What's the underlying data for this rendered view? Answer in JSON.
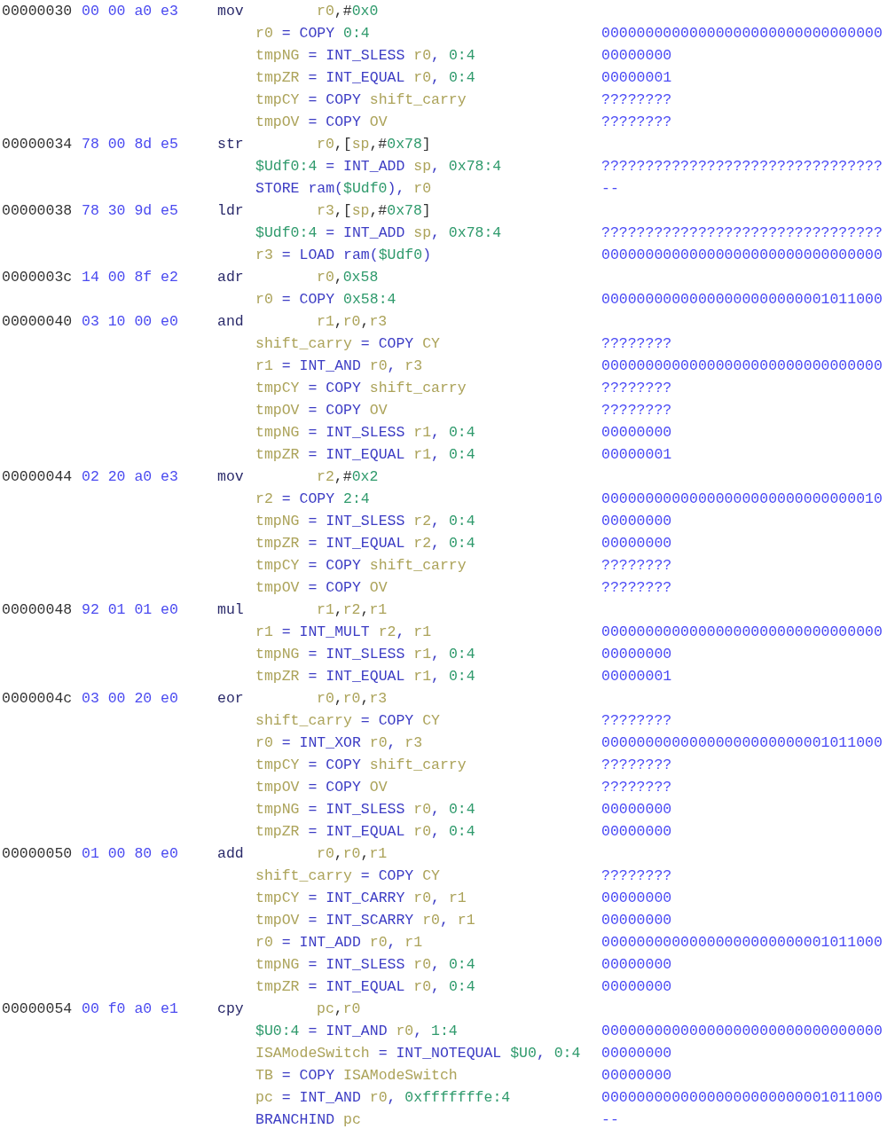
{
  "listing": [
    {
      "address": "00000030",
      "bytes": "00 00 a0 e3",
      "mnemonic": "mov",
      "operands": [
        {
          "kind": "var",
          "text": "r0"
        },
        {
          "kind": "plain",
          "text": ",#"
        },
        {
          "kind": "const",
          "text": "0x0"
        }
      ],
      "pcode": [
        {
          "tokens": [
            {
              "kind": "var",
              "text": "r0"
            },
            {
              "kind": "sym",
              "text": " = "
            },
            {
              "kind": "op",
              "text": "COPY"
            },
            {
              "kind": "const",
              "text": "0:4"
            }
          ],
          "value": "00000000000000000000000000000000"
        },
        {
          "tokens": [
            {
              "kind": "var",
              "text": "tmpNG"
            },
            {
              "kind": "sym",
              "text": " = "
            },
            {
              "kind": "op",
              "text": "INT_SLESS"
            },
            {
              "kind": "var",
              "text": "r0"
            },
            {
              "kind": "sym",
              "text": ", "
            },
            {
              "kind": "const",
              "text": "0:4"
            }
          ],
          "value": "00000000"
        },
        {
          "tokens": [
            {
              "kind": "var",
              "text": "tmpZR"
            },
            {
              "kind": "sym",
              "text": " = "
            },
            {
              "kind": "op",
              "text": "INT_EQUAL"
            },
            {
              "kind": "var",
              "text": "r0"
            },
            {
              "kind": "sym",
              "text": ", "
            },
            {
              "kind": "const",
              "text": "0:4"
            }
          ],
          "value": "00000001"
        },
        {
          "tokens": [
            {
              "kind": "var",
              "text": "tmpCY"
            },
            {
              "kind": "sym",
              "text": " = "
            },
            {
              "kind": "op",
              "text": "COPY"
            },
            {
              "kind": "var",
              "text": "shift_carry"
            }
          ],
          "value": "????????"
        },
        {
          "tokens": [
            {
              "kind": "var",
              "text": "tmpOV"
            },
            {
              "kind": "sym",
              "text": " = "
            },
            {
              "kind": "op",
              "text": "COPY"
            },
            {
              "kind": "var",
              "text": "OV"
            }
          ],
          "value": "????????"
        }
      ]
    },
    {
      "address": "00000034",
      "bytes": "78 00 8d e5",
      "mnemonic": "str",
      "operands": [
        {
          "kind": "var",
          "text": "r0"
        },
        {
          "kind": "plain",
          "text": ",["
        },
        {
          "kind": "var",
          "text": "sp"
        },
        {
          "kind": "plain",
          "text": ",#"
        },
        {
          "kind": "const",
          "text": "0x78"
        },
        {
          "kind": "plain",
          "text": "]"
        }
      ],
      "pcode": [
        {
          "tokens": [
            {
              "kind": "unique",
              "text": "$Udf0:4"
            },
            {
              "kind": "sym",
              "text": " = "
            },
            {
              "kind": "op",
              "text": "INT_ADD"
            },
            {
              "kind": "var",
              "text": "sp"
            },
            {
              "kind": "sym",
              "text": ", "
            },
            {
              "kind": "const",
              "text": "0x78:4"
            }
          ],
          "value": "????????????????????????????????"
        },
        {
          "tokens": [
            {
              "kind": "op",
              "text": "STORE"
            },
            {
              "kind": "sym",
              "text": "ram("
            },
            {
              "kind": "unique",
              "text": "$Udf0"
            },
            {
              "kind": "sym",
              "text": "), "
            },
            {
              "kind": "var",
              "text": "r0"
            }
          ],
          "value": "--"
        }
      ]
    },
    {
      "address": "00000038",
      "bytes": "78 30 9d e5",
      "mnemonic": "ldr",
      "operands": [
        {
          "kind": "var",
          "text": "r3"
        },
        {
          "kind": "plain",
          "text": ",["
        },
        {
          "kind": "var",
          "text": "sp"
        },
        {
          "kind": "plain",
          "text": ",#"
        },
        {
          "kind": "const",
          "text": "0x78"
        },
        {
          "kind": "plain",
          "text": "]"
        }
      ],
      "pcode": [
        {
          "tokens": [
            {
              "kind": "unique",
              "text": "$Udf0:4"
            },
            {
              "kind": "sym",
              "text": " = "
            },
            {
              "kind": "op",
              "text": "INT_ADD"
            },
            {
              "kind": "var",
              "text": "sp"
            },
            {
              "kind": "sym",
              "text": ", "
            },
            {
              "kind": "const",
              "text": "0x78:4"
            }
          ],
          "value": "????????????????????????????????"
        },
        {
          "tokens": [
            {
              "kind": "var",
              "text": "r3"
            },
            {
              "kind": "sym",
              "text": " = "
            },
            {
              "kind": "op",
              "text": "LOAD"
            },
            {
              "kind": "sym",
              "text": "ram("
            },
            {
              "kind": "unique",
              "text": "$Udf0"
            },
            {
              "kind": "sym",
              "text": ")"
            }
          ],
          "value": "00000000000000000000000000000000"
        }
      ]
    },
    {
      "address": "0000003c",
      "bytes": "14 00 8f e2",
      "mnemonic": "adr",
      "operands": [
        {
          "kind": "var",
          "text": "r0"
        },
        {
          "kind": "plain",
          "text": ","
        },
        {
          "kind": "const",
          "text": "0x58"
        }
      ],
      "pcode": [
        {
          "tokens": [
            {
              "kind": "var",
              "text": "r0"
            },
            {
              "kind": "sym",
              "text": " = "
            },
            {
              "kind": "op",
              "text": "COPY"
            },
            {
              "kind": "const",
              "text": "0x58:4"
            }
          ],
          "value": "00000000000000000000000001011000"
        }
      ]
    },
    {
      "address": "00000040",
      "bytes": "03 10 00 e0",
      "mnemonic": "and",
      "operands": [
        {
          "kind": "var",
          "text": "r1"
        },
        {
          "kind": "plain",
          "text": ","
        },
        {
          "kind": "var",
          "text": "r0"
        },
        {
          "kind": "plain",
          "text": ","
        },
        {
          "kind": "var",
          "text": "r3"
        }
      ],
      "pcode": [
        {
          "tokens": [
            {
              "kind": "var",
              "text": "shift_carry"
            },
            {
              "kind": "sym",
              "text": " = "
            },
            {
              "kind": "op",
              "text": "COPY"
            },
            {
              "kind": "var",
              "text": "CY"
            }
          ],
          "value": "????????"
        },
        {
          "tokens": [
            {
              "kind": "var",
              "text": "r1"
            },
            {
              "kind": "sym",
              "text": " = "
            },
            {
              "kind": "op",
              "text": "INT_AND"
            },
            {
              "kind": "var",
              "text": "r0"
            },
            {
              "kind": "sym",
              "text": ", "
            },
            {
              "kind": "var",
              "text": "r3"
            }
          ],
          "value": "00000000000000000000000000000000"
        },
        {
          "tokens": [
            {
              "kind": "var",
              "text": "tmpCY"
            },
            {
              "kind": "sym",
              "text": " = "
            },
            {
              "kind": "op",
              "text": "COPY"
            },
            {
              "kind": "var",
              "text": "shift_carry"
            }
          ],
          "value": "????????"
        },
        {
          "tokens": [
            {
              "kind": "var",
              "text": "tmpOV"
            },
            {
              "kind": "sym",
              "text": " = "
            },
            {
              "kind": "op",
              "text": "COPY"
            },
            {
              "kind": "var",
              "text": "OV"
            }
          ],
          "value": "????????"
        },
        {
          "tokens": [
            {
              "kind": "var",
              "text": "tmpNG"
            },
            {
              "kind": "sym",
              "text": " = "
            },
            {
              "kind": "op",
              "text": "INT_SLESS"
            },
            {
              "kind": "var",
              "text": "r1"
            },
            {
              "kind": "sym",
              "text": ", "
            },
            {
              "kind": "const",
              "text": "0:4"
            }
          ],
          "value": "00000000"
        },
        {
          "tokens": [
            {
              "kind": "var",
              "text": "tmpZR"
            },
            {
              "kind": "sym",
              "text": " = "
            },
            {
              "kind": "op",
              "text": "INT_EQUAL"
            },
            {
              "kind": "var",
              "text": "r1"
            },
            {
              "kind": "sym",
              "text": ", "
            },
            {
              "kind": "const",
              "text": "0:4"
            }
          ],
          "value": "00000001"
        }
      ]
    },
    {
      "address": "00000044",
      "bytes": "02 20 a0 e3",
      "mnemonic": "mov",
      "operands": [
        {
          "kind": "var",
          "text": "r2"
        },
        {
          "kind": "plain",
          "text": ",#"
        },
        {
          "kind": "const",
          "text": "0x2"
        }
      ],
      "pcode": [
        {
          "tokens": [
            {
              "kind": "var",
              "text": "r2"
            },
            {
              "kind": "sym",
              "text": " = "
            },
            {
              "kind": "op",
              "text": "COPY"
            },
            {
              "kind": "const",
              "text": "2:4"
            }
          ],
          "value": "00000000000000000000000000000010"
        },
        {
          "tokens": [
            {
              "kind": "var",
              "text": "tmpNG"
            },
            {
              "kind": "sym",
              "text": " = "
            },
            {
              "kind": "op",
              "text": "INT_SLESS"
            },
            {
              "kind": "var",
              "text": "r2"
            },
            {
              "kind": "sym",
              "text": ", "
            },
            {
              "kind": "const",
              "text": "0:4"
            }
          ],
          "value": "00000000"
        },
        {
          "tokens": [
            {
              "kind": "var",
              "text": "tmpZR"
            },
            {
              "kind": "sym",
              "text": " = "
            },
            {
              "kind": "op",
              "text": "INT_EQUAL"
            },
            {
              "kind": "var",
              "text": "r2"
            },
            {
              "kind": "sym",
              "text": ", "
            },
            {
              "kind": "const",
              "text": "0:4"
            }
          ],
          "value": "00000000"
        },
        {
          "tokens": [
            {
              "kind": "var",
              "text": "tmpCY"
            },
            {
              "kind": "sym",
              "text": " = "
            },
            {
              "kind": "op",
              "text": "COPY"
            },
            {
              "kind": "var",
              "text": "shift_carry"
            }
          ],
          "value": "????????"
        },
        {
          "tokens": [
            {
              "kind": "var",
              "text": "tmpOV"
            },
            {
              "kind": "sym",
              "text": " = "
            },
            {
              "kind": "op",
              "text": "COPY"
            },
            {
              "kind": "var",
              "text": "OV"
            }
          ],
          "value": "????????"
        }
      ]
    },
    {
      "address": "00000048",
      "bytes": "92 01 01 e0",
      "mnemonic": "mul",
      "operands": [
        {
          "kind": "var",
          "text": "r1"
        },
        {
          "kind": "plain",
          "text": ","
        },
        {
          "kind": "var",
          "text": "r2"
        },
        {
          "kind": "plain",
          "text": ","
        },
        {
          "kind": "var",
          "text": "r1"
        }
      ],
      "pcode": [
        {
          "tokens": [
            {
              "kind": "var",
              "text": "r1"
            },
            {
              "kind": "sym",
              "text": " = "
            },
            {
              "kind": "op",
              "text": "INT_MULT"
            },
            {
              "kind": "var",
              "text": "r2"
            },
            {
              "kind": "sym",
              "text": ", "
            },
            {
              "kind": "var",
              "text": "r1"
            }
          ],
          "value": "00000000000000000000000000000000"
        },
        {
          "tokens": [
            {
              "kind": "var",
              "text": "tmpNG"
            },
            {
              "kind": "sym",
              "text": " = "
            },
            {
              "kind": "op",
              "text": "INT_SLESS"
            },
            {
              "kind": "var",
              "text": "r1"
            },
            {
              "kind": "sym",
              "text": ", "
            },
            {
              "kind": "const",
              "text": "0:4"
            }
          ],
          "value": "00000000"
        },
        {
          "tokens": [
            {
              "kind": "var",
              "text": "tmpZR"
            },
            {
              "kind": "sym",
              "text": " = "
            },
            {
              "kind": "op",
              "text": "INT_EQUAL"
            },
            {
              "kind": "var",
              "text": "r1"
            },
            {
              "kind": "sym",
              "text": ", "
            },
            {
              "kind": "const",
              "text": "0:4"
            }
          ],
          "value": "00000001"
        }
      ]
    },
    {
      "address": "0000004c",
      "bytes": "03 00 20 e0",
      "mnemonic": "eor",
      "operands": [
        {
          "kind": "var",
          "text": "r0"
        },
        {
          "kind": "plain",
          "text": ","
        },
        {
          "kind": "var",
          "text": "r0"
        },
        {
          "kind": "plain",
          "text": ","
        },
        {
          "kind": "var",
          "text": "r3"
        }
      ],
      "pcode": [
        {
          "tokens": [
            {
              "kind": "var",
              "text": "shift_carry"
            },
            {
              "kind": "sym",
              "text": " = "
            },
            {
              "kind": "op",
              "text": "COPY"
            },
            {
              "kind": "var",
              "text": "CY"
            }
          ],
          "value": "????????"
        },
        {
          "tokens": [
            {
              "kind": "var",
              "text": "r0"
            },
            {
              "kind": "sym",
              "text": " = "
            },
            {
              "kind": "op",
              "text": "INT_XOR"
            },
            {
              "kind": "var",
              "text": "r0"
            },
            {
              "kind": "sym",
              "text": ", "
            },
            {
              "kind": "var",
              "text": "r3"
            }
          ],
          "value": "00000000000000000000000001011000"
        },
        {
          "tokens": [
            {
              "kind": "var",
              "text": "tmpCY"
            },
            {
              "kind": "sym",
              "text": " = "
            },
            {
              "kind": "op",
              "text": "COPY"
            },
            {
              "kind": "var",
              "text": "shift_carry"
            }
          ],
          "value": "????????"
        },
        {
          "tokens": [
            {
              "kind": "var",
              "text": "tmpOV"
            },
            {
              "kind": "sym",
              "text": " = "
            },
            {
              "kind": "op",
              "text": "COPY"
            },
            {
              "kind": "var",
              "text": "OV"
            }
          ],
          "value": "????????"
        },
        {
          "tokens": [
            {
              "kind": "var",
              "text": "tmpNG"
            },
            {
              "kind": "sym",
              "text": " = "
            },
            {
              "kind": "op",
              "text": "INT_SLESS"
            },
            {
              "kind": "var",
              "text": "r0"
            },
            {
              "kind": "sym",
              "text": ", "
            },
            {
              "kind": "const",
              "text": "0:4"
            }
          ],
          "value": "00000000"
        },
        {
          "tokens": [
            {
              "kind": "var",
              "text": "tmpZR"
            },
            {
              "kind": "sym",
              "text": " = "
            },
            {
              "kind": "op",
              "text": "INT_EQUAL"
            },
            {
              "kind": "var",
              "text": "r0"
            },
            {
              "kind": "sym",
              "text": ", "
            },
            {
              "kind": "const",
              "text": "0:4"
            }
          ],
          "value": "00000000"
        }
      ]
    },
    {
      "address": "00000050",
      "bytes": "01 00 80 e0",
      "mnemonic": "add",
      "operands": [
        {
          "kind": "var",
          "text": "r0"
        },
        {
          "kind": "plain",
          "text": ","
        },
        {
          "kind": "var",
          "text": "r0"
        },
        {
          "kind": "plain",
          "text": ","
        },
        {
          "kind": "var",
          "text": "r1"
        }
      ],
      "pcode": [
        {
          "tokens": [
            {
              "kind": "var",
              "text": "shift_carry"
            },
            {
              "kind": "sym",
              "text": " = "
            },
            {
              "kind": "op",
              "text": "COPY"
            },
            {
              "kind": "var",
              "text": "CY"
            }
          ],
          "value": "????????"
        },
        {
          "tokens": [
            {
              "kind": "var",
              "text": "tmpCY"
            },
            {
              "kind": "sym",
              "text": " = "
            },
            {
              "kind": "op",
              "text": "INT_CARRY"
            },
            {
              "kind": "var",
              "text": "r0"
            },
            {
              "kind": "sym",
              "text": ", "
            },
            {
              "kind": "var",
              "text": "r1"
            }
          ],
          "value": "00000000"
        },
        {
          "tokens": [
            {
              "kind": "var",
              "text": "tmpOV"
            },
            {
              "kind": "sym",
              "text": " = "
            },
            {
              "kind": "op",
              "text": "INT_SCARRY"
            },
            {
              "kind": "var",
              "text": "r0"
            },
            {
              "kind": "sym",
              "text": ", "
            },
            {
              "kind": "var",
              "text": "r1"
            }
          ],
          "value": "00000000"
        },
        {
          "tokens": [
            {
              "kind": "var",
              "text": "r0"
            },
            {
              "kind": "sym",
              "text": " = "
            },
            {
              "kind": "op",
              "text": "INT_ADD"
            },
            {
              "kind": "var",
              "text": "r0"
            },
            {
              "kind": "sym",
              "text": ", "
            },
            {
              "kind": "var",
              "text": "r1"
            }
          ],
          "value": "00000000000000000000000001011000"
        },
        {
          "tokens": [
            {
              "kind": "var",
              "text": "tmpNG"
            },
            {
              "kind": "sym",
              "text": " = "
            },
            {
              "kind": "op",
              "text": "INT_SLESS"
            },
            {
              "kind": "var",
              "text": "r0"
            },
            {
              "kind": "sym",
              "text": ", "
            },
            {
              "kind": "const",
              "text": "0:4"
            }
          ],
          "value": "00000000"
        },
        {
          "tokens": [
            {
              "kind": "var",
              "text": "tmpZR"
            },
            {
              "kind": "sym",
              "text": " = "
            },
            {
              "kind": "op",
              "text": "INT_EQUAL"
            },
            {
              "kind": "var",
              "text": "r0"
            },
            {
              "kind": "sym",
              "text": ", "
            },
            {
              "kind": "const",
              "text": "0:4"
            }
          ],
          "value": "00000000"
        }
      ]
    },
    {
      "address": "00000054",
      "bytes": "00 f0 a0 e1",
      "mnemonic": "cpy",
      "operands": [
        {
          "kind": "var",
          "text": "pc"
        },
        {
          "kind": "plain",
          "text": ","
        },
        {
          "kind": "var",
          "text": "r0"
        }
      ],
      "pcode": [
        {
          "tokens": [
            {
              "kind": "unique",
              "text": "$U0:4"
            },
            {
              "kind": "sym",
              "text": " = "
            },
            {
              "kind": "op",
              "text": "INT_AND"
            },
            {
              "kind": "var",
              "text": "r0"
            },
            {
              "kind": "sym",
              "text": ", "
            },
            {
              "kind": "const",
              "text": "1:4"
            }
          ],
          "value": "00000000000000000000000000000000"
        },
        {
          "tokens": [
            {
              "kind": "var",
              "text": "ISAModeSwitch"
            },
            {
              "kind": "sym",
              "text": " = "
            },
            {
              "kind": "op",
              "text": "INT_NOTEQUAL"
            },
            {
              "kind": "unique",
              "text": "$U0"
            },
            {
              "kind": "sym",
              "text": ", "
            },
            {
              "kind": "const",
              "text": "0:4"
            }
          ],
          "value": "00000000"
        },
        {
          "tokens": [
            {
              "kind": "var",
              "text": "TB"
            },
            {
              "kind": "sym",
              "text": " = "
            },
            {
              "kind": "op",
              "text": "COPY"
            },
            {
              "kind": "var",
              "text": "ISAModeSwitch"
            }
          ],
          "value": "00000000"
        },
        {
          "tokens": [
            {
              "kind": "var",
              "text": "pc"
            },
            {
              "kind": "sym",
              "text": " = "
            },
            {
              "kind": "op",
              "text": "INT_AND"
            },
            {
              "kind": "var",
              "text": "r0"
            },
            {
              "kind": "sym",
              "text": ", "
            },
            {
              "kind": "const",
              "text": "0xfffffffe:4"
            }
          ],
          "value": "00000000000000000000000001011000"
        },
        {
          "tokens": [
            {
              "kind": "op",
              "text": "BRANCHIND"
            },
            {
              "kind": "var",
              "text": "pc"
            }
          ],
          "value": "--"
        }
      ]
    }
  ]
}
